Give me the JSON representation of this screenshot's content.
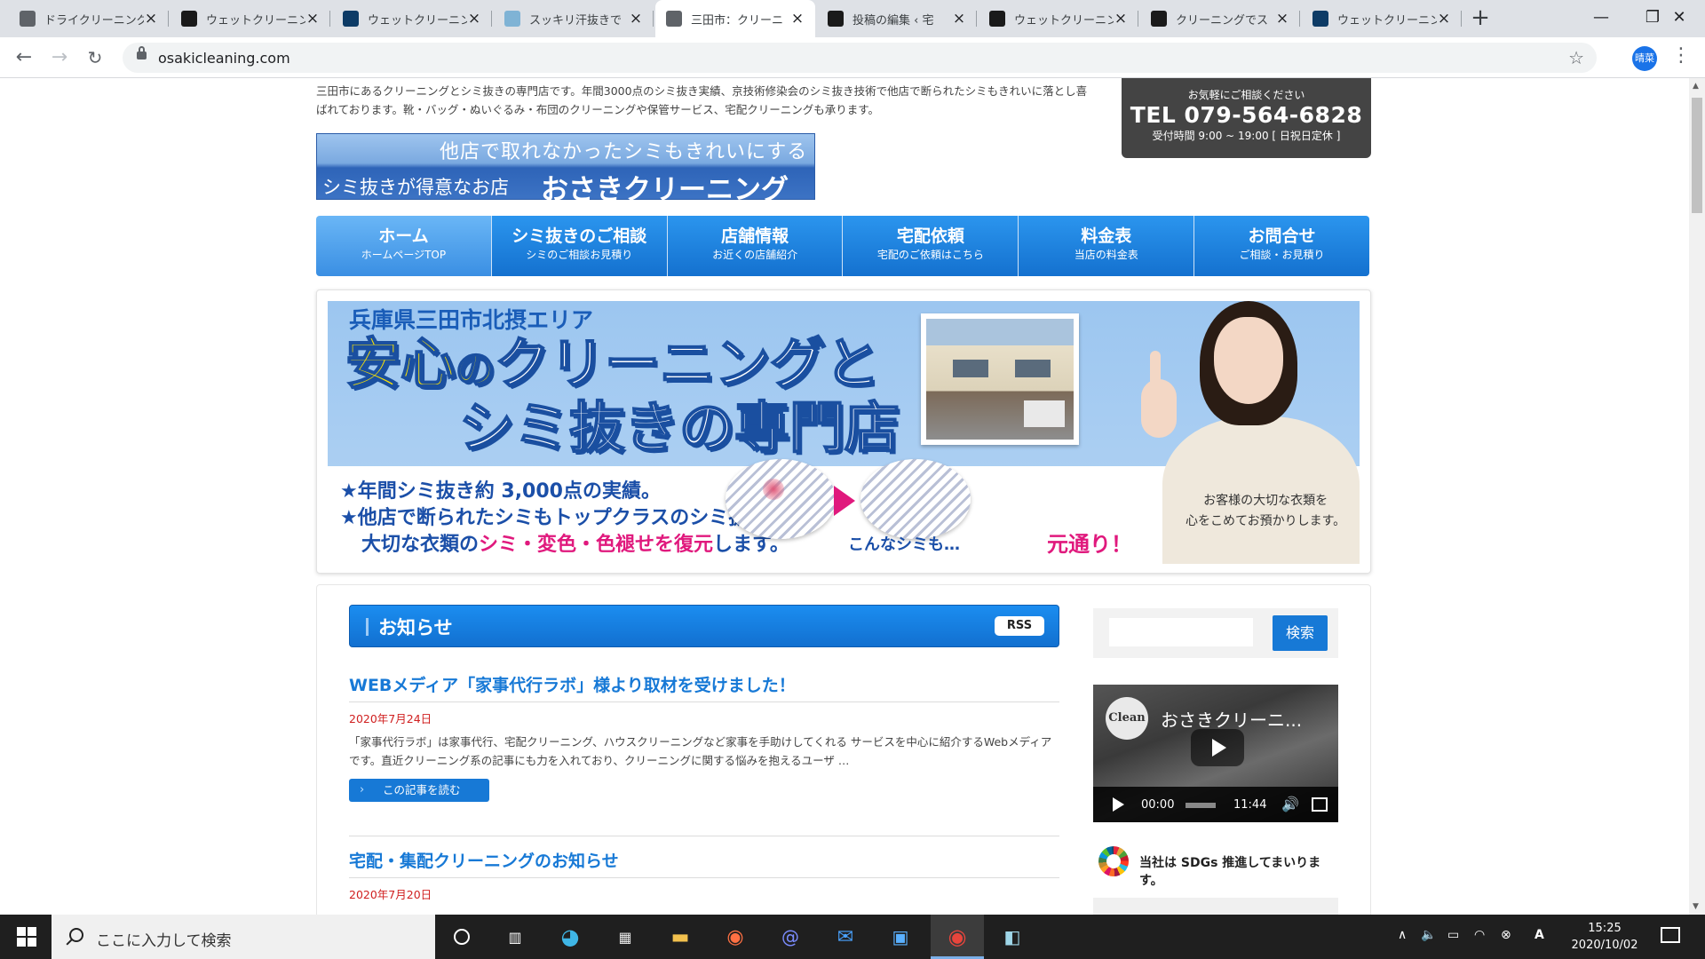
{
  "browser": {
    "tabs": [
      {
        "label": "ドライクリーニング",
        "icon": "globe-icon",
        "color": "#5f6368",
        "active": false
      },
      {
        "label": "ウェットクリーニング",
        "icon": "osaki-favicon",
        "color": "#1a1a1a",
        "active": false
      },
      {
        "label": "ウェットクリーニング",
        "icon": "site-favicon",
        "color": "#0d3b66",
        "active": false
      },
      {
        "label": "スッキリ汗抜きで",
        "icon": "circle-favicon",
        "color": "#7fb3d5",
        "active": false
      },
      {
        "label": "三田市：クリーニ",
        "icon": "globe-icon",
        "color": "#5f6368",
        "active": true
      },
      {
        "label": "投稿の編集 ‹ 宅",
        "icon": "osaki-favicon",
        "color": "#1a1a1a",
        "active": false
      },
      {
        "label": "ウェットクリーニング",
        "icon": "osaki-favicon",
        "color": "#1a1a1a",
        "active": false
      },
      {
        "label": "クリーニングでス",
        "icon": "osaki-favicon",
        "color": "#1a1a1a",
        "active": false
      },
      {
        "label": "ウェットクリーニング",
        "icon": "site-favicon",
        "color": "#0d3b66",
        "active": false
      }
    ],
    "url": "osakicleaning.com",
    "profile_label": "晴菜"
  },
  "site": {
    "intro": "三田市にあるクリーニングとシミ抜きの専門店です。年間3000点のシミ抜き実績、京技術修染会のシミ抜き技術で他店で断られたシミもきれいに落とし喜ばれております。靴・バッグ・ぬいぐるみ・布団のクリーニングや保管サービス、宅配クリーニングも承ります。",
    "banner": {
      "line1": "他店で取れなかったシミもきれいにする",
      "line2a": "シミ抜きが得意なお店",
      "line2b": "おさきクリーニング"
    },
    "contact": {
      "lead": "お気軽にご相談ください",
      "tel": "TEL 079-564-6828",
      "hours": "受付時間 9:00 ~ 19:00 [ 日祝日定休 ]"
    },
    "nav": [
      {
        "main": "ホーム",
        "sub": "ホームページTOP"
      },
      {
        "main": "シミ抜きのご相談",
        "sub": "シミのご相談お見積り"
      },
      {
        "main": "店舗情報",
        "sub": "お近くの店舗紹介"
      },
      {
        "main": "宅配依頼",
        "sub": "宅配のご依頼はこちら"
      },
      {
        "main": "料金表",
        "sub": "当店の料金表"
      },
      {
        "main": "お問合せ",
        "sub": "ご相談・お見積り"
      }
    ],
    "hero": {
      "area": "兵庫県三田市北摂エリア",
      "headline1_a": "安心",
      "headline1_b": "の",
      "headline1_c": "クリーニングと",
      "headline2": "シミ抜きの専門店",
      "bullet1": "★年間シミ抜き約 3,000点の実績。",
      "bullet2": "★他店で断られたシミもトップクラスのシミ抜き技術で",
      "bullet3_a": "大切な衣類の",
      "bullet3_b": "シミ・変色・色褪せを復元",
      "bullet3_c": "します。",
      "before": "こんなシミも…",
      "after": "元通り！",
      "caption1": "お客様の大切な衣類を",
      "caption2": "心をこめてお預かりします。"
    },
    "news": {
      "heading": "お知らせ",
      "rss": "RSS",
      "posts": [
        {
          "title": "WEBメディア「家事代行ラボ」様より取材を受けました！",
          "date": "2020年7月24日",
          "excerpt": "「家事代行ラボ」は家事代行、宅配クリーニング、ハウスクリーニングなど家事を手助けしてくれる サービスを中心に紹介するWebメディアです。直近クリーニング系の記事にも力を入れており、クリーニングに関する悩みを抱えるユーザ …",
          "more": "この記事を読む"
        },
        {
          "title": "宅配・集配クリーニングのお知らせ",
          "date": "2020年7月20日"
        }
      ]
    },
    "sidebar": {
      "search_button": "検索",
      "search_placeholder": "",
      "video": {
        "channel": "Clean",
        "title": "おさきクリーニ...",
        "time_current": "00:00",
        "time_total": "11:44"
      },
      "sdgs": "当社は SDGs 推進してまいります。"
    }
  },
  "taskbar": {
    "search_placeholder": "ここに入力して検索",
    "time": "15:25",
    "date": "2020/10/02"
  },
  "colors": {
    "accent": "#1779d6",
    "nav_blue": "#1471cf",
    "pink": "#e0197d",
    "date_red": "#d02020"
  }
}
